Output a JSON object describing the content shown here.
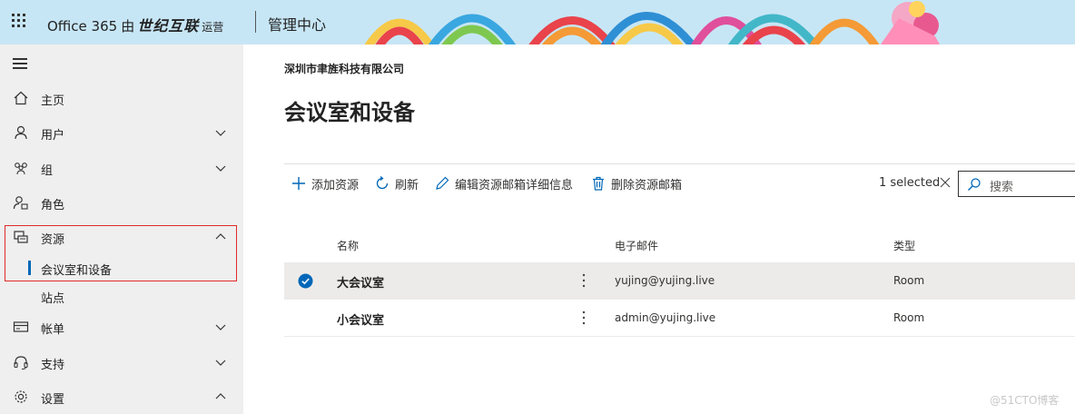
{
  "header": {
    "product": "Office 365",
    "by": "由",
    "company": "世纪互联",
    "operated": "运营",
    "admin_center": "管理中心"
  },
  "sidebar": {
    "items": [
      {
        "label": "主页",
        "icon": "home-icon"
      },
      {
        "label": "用户",
        "icon": "user-icon",
        "expanded": false
      },
      {
        "label": "组",
        "icon": "group-icon",
        "expanded": false
      },
      {
        "label": "角色",
        "icon": "role-icon"
      },
      {
        "label": "资源",
        "icon": "resources-icon",
        "expanded": true
      },
      {
        "label": "帐单",
        "icon": "billing-icon",
        "expanded": false
      },
      {
        "label": "支持",
        "icon": "headset-icon",
        "expanded": false
      },
      {
        "label": "设置",
        "icon": "gear-icon",
        "expanded": true
      }
    ],
    "sub_items": [
      {
        "label": "会议室和设备",
        "active": true
      },
      {
        "label": "站点",
        "active": false
      }
    ]
  },
  "main": {
    "org_name": "深圳市聿旌科技有限公司",
    "page_title": "会议室和设备",
    "commands": [
      {
        "label": "添加资源",
        "icon": "plus-icon"
      },
      {
        "label": "刷新",
        "icon": "refresh-icon"
      },
      {
        "label": "编辑资源邮箱详细信息",
        "icon": "edit-icon"
      },
      {
        "label": "删除资源邮箱",
        "icon": "trash-icon"
      }
    ],
    "selection": "1 selected",
    "search_placeholder": "搜索",
    "columns": [
      "名称",
      "电子邮件",
      "类型"
    ],
    "rows": [
      {
        "name": "大会议室",
        "email": "yujing@yujing.live",
        "type": "Room",
        "selected": true
      },
      {
        "name": "小会议室",
        "email": "admin@yujing.live",
        "type": "Room",
        "selected": false
      }
    ]
  },
  "watermark": "@51CTO博客",
  "colors": {
    "accent": "#0067b8",
    "header_bg": "#c7e6f5",
    "sidebar_bg": "#efefef",
    "highlight_border": "#e02a2a"
  }
}
